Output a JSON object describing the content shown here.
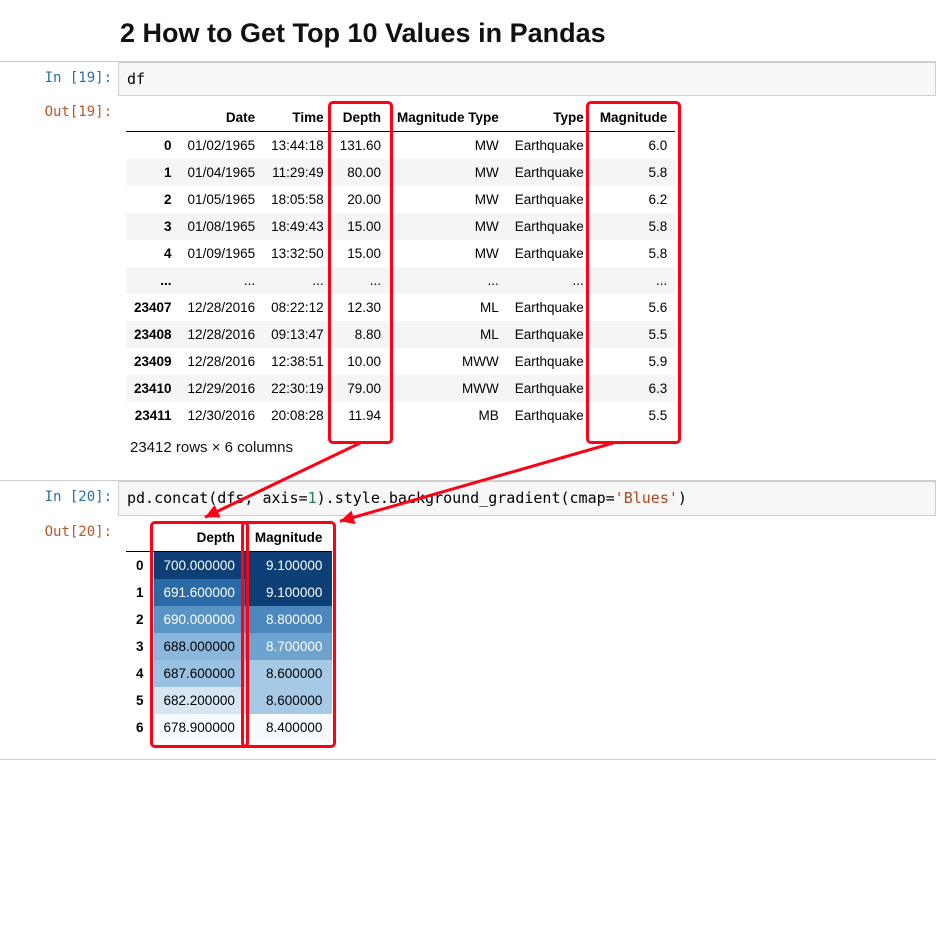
{
  "heading": "2  How to Get Top 10 Values in Pandas",
  "cell19": {
    "in_prompt": "In [19]:",
    "out_prompt": "Out[19]:",
    "code": "df",
    "columns": [
      "Date",
      "Time",
      "Depth",
      "Magnitude Type",
      "Type",
      "Magnitude"
    ],
    "rows": [
      {
        "idx": "0",
        "Date": "01/02/1965",
        "Time": "13:44:18",
        "Depth": "131.60",
        "MagType": "MW",
        "Type": "Earthquake",
        "Magnitude": "6.0"
      },
      {
        "idx": "1",
        "Date": "01/04/1965",
        "Time": "11:29:49",
        "Depth": "80.00",
        "MagType": "MW",
        "Type": "Earthquake",
        "Magnitude": "5.8"
      },
      {
        "idx": "2",
        "Date": "01/05/1965",
        "Time": "18:05:58",
        "Depth": "20.00",
        "MagType": "MW",
        "Type": "Earthquake",
        "Magnitude": "6.2"
      },
      {
        "idx": "3",
        "Date": "01/08/1965",
        "Time": "18:49:43",
        "Depth": "15.00",
        "MagType": "MW",
        "Type": "Earthquake",
        "Magnitude": "5.8"
      },
      {
        "idx": "4",
        "Date": "01/09/1965",
        "Time": "13:32:50",
        "Depth": "15.00",
        "MagType": "MW",
        "Type": "Earthquake",
        "Magnitude": "5.8"
      },
      {
        "idx": "...",
        "Date": "...",
        "Time": "...",
        "Depth": "...",
        "MagType": "...",
        "Type": "...",
        "Magnitude": "..."
      },
      {
        "idx": "23407",
        "Date": "12/28/2016",
        "Time": "08:22:12",
        "Depth": "12.30",
        "MagType": "ML",
        "Type": "Earthquake",
        "Magnitude": "5.6"
      },
      {
        "idx": "23408",
        "Date": "12/28/2016",
        "Time": "09:13:47",
        "Depth": "8.80",
        "MagType": "ML",
        "Type": "Earthquake",
        "Magnitude": "5.5"
      },
      {
        "idx": "23409",
        "Date": "12/28/2016",
        "Time": "12:38:51",
        "Depth": "10.00",
        "MagType": "MWW",
        "Type": "Earthquake",
        "Magnitude": "5.9"
      },
      {
        "idx": "23410",
        "Date": "12/29/2016",
        "Time": "22:30:19",
        "Depth": "79.00",
        "MagType": "MWW",
        "Type": "Earthquake",
        "Magnitude": "6.3"
      },
      {
        "idx": "23411",
        "Date": "12/30/2016",
        "Time": "20:08:28",
        "Depth": "11.94",
        "MagType": "MB",
        "Type": "Earthquake",
        "Magnitude": "5.5"
      }
    ],
    "shape_note": "23412 rows × 6 columns"
  },
  "cell20": {
    "in_prompt": "In [20]:",
    "out_prompt": "Out[20]:",
    "code_plain": "pd.concat(dfs, axis=1).style.background_gradient(cmap='Blues')",
    "code_parts": {
      "p1": "pd.concat(dfs, axis=",
      "num": "1",
      "p2": ").style.background_gradient(cmap=",
      "str": "'Blues'",
      "p3": ")"
    },
    "columns": [
      "Depth",
      "Magnitude"
    ],
    "rows": [
      {
        "idx": "0",
        "Depth": "700.000000",
        "Magnitude": "9.100000",
        "dbg": "#0b3f76",
        "mbg": "#0b3f76",
        "dfg": "#fff",
        "mfg": "#fff"
      },
      {
        "idx": "1",
        "Depth": "691.600000",
        "Magnitude": "9.100000",
        "dbg": "#2a6aa7",
        "mbg": "#0b3f76",
        "dfg": "#fff",
        "mfg": "#fff"
      },
      {
        "idx": "2",
        "Depth": "690.000000",
        "Magnitude": "8.800000",
        "dbg": "#5a93c6",
        "mbg": "#4c87be",
        "dfg": "#fff",
        "mfg": "#fff"
      },
      {
        "idx": "3",
        "Depth": "688.000000",
        "Magnitude": "8.700000",
        "dbg": "#8bb7dc",
        "mbg": "#6ea3d0",
        "dfg": "#000",
        "mfg": "#fff"
      },
      {
        "idx": "4",
        "Depth": "687.600000",
        "Magnitude": "8.600000",
        "dbg": "#99c1e1",
        "mbg": "#a6c9e5",
        "dfg": "#000",
        "mfg": "#000"
      },
      {
        "idx": "5",
        "Depth": "682.200000",
        "Magnitude": "8.600000",
        "dbg": "#d7e6f3",
        "mbg": "#a6c9e5",
        "dfg": "#000",
        "mfg": "#000"
      },
      {
        "idx": "6",
        "Depth": "678.900000",
        "Magnitude": "8.400000",
        "dbg": "#f7fbff",
        "mbg": "#f7fbff",
        "dfg": "#000",
        "mfg": "#000"
      }
    ]
  }
}
